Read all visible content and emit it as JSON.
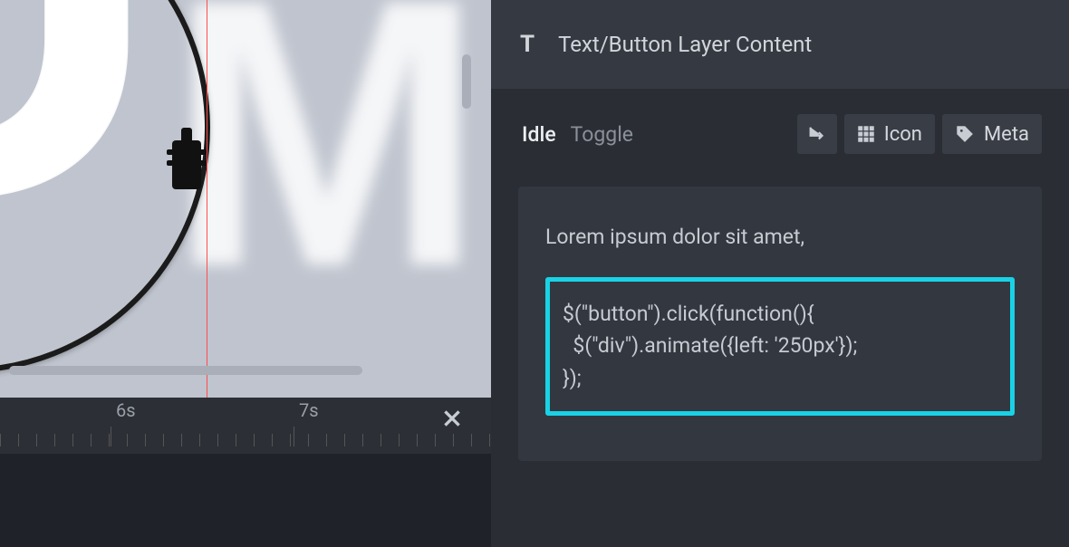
{
  "panel": {
    "title": "Text/Button Layer Content",
    "tabs": {
      "idle": "Idle",
      "toggle": "Toggle"
    },
    "buttons": {
      "icon": "Icon",
      "meta": "Meta"
    }
  },
  "content": {
    "intro": "Lorem ipsum dolor sit amet,",
    "code": "$(\"button\").click(function(){\n  $(\"div\").animate({left: '250px'});\n});"
  },
  "timeline": {
    "six": "6s",
    "seven": "7s"
  },
  "preview": {
    "letter": "M"
  }
}
